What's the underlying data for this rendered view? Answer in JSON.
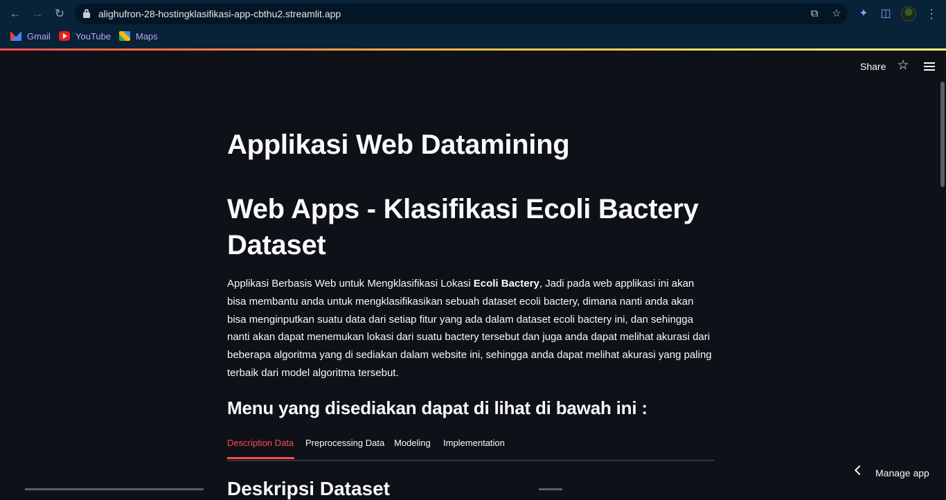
{
  "browser": {
    "url": "alighufron-28-hostingklasifikasi-app-cbthu2.streamlit.app",
    "bookmarks": [
      {
        "label": "Gmail",
        "icon": "gmail-icon"
      },
      {
        "label": "YouTube",
        "icon": "youtube-icon"
      },
      {
        "label": "Maps",
        "icon": "maps-icon"
      }
    ]
  },
  "app_toolbar": {
    "share_label": "Share"
  },
  "main": {
    "title": "Applikasi Web Datamining",
    "subtitle": "Web Apps - Klasifikasi Ecoli Bactery Dataset",
    "description_before": "Applikasi Berbasis Web untuk Mengklasifikasi Lokasi ",
    "description_bold": "Ecoli Bactery",
    "description_after": ", Jadi pada web applikasi ini akan bisa membantu anda untuk mengklasifikasikan sebuah dataset ecoli bactery, dimana nanti anda akan bisa menginputkan suatu data dari setiap fitur yang ada dalam dataset ecoli bactery ini, dan sehingga nanti akan dapat menemukan lokasi dari suatu bactery tersebut dan juga anda dapat melihat akurasi dari beberapa algoritma yang di sediakan dalam website ini, sehingga anda dapat melihat akurasi yang paling terbaik dari model algoritma tersebut.",
    "menu_heading": "Menu yang disediakan dapat di lihat di bawah ini :",
    "tabs": [
      {
        "label": "Description Data",
        "active": true
      },
      {
        "label": "Preprocessing Data",
        "active": false
      },
      {
        "label": "Modeling",
        "active": false
      },
      {
        "label": "Implementation",
        "active": false
      }
    ],
    "section_heading": "Deskripsi Dataset"
  },
  "footer": {
    "manage_app_label": "Manage app"
  },
  "colors": {
    "background": "#0e1117",
    "text": "#fafafa",
    "accent": "#ff4b4b",
    "chrome": "#082238"
  }
}
